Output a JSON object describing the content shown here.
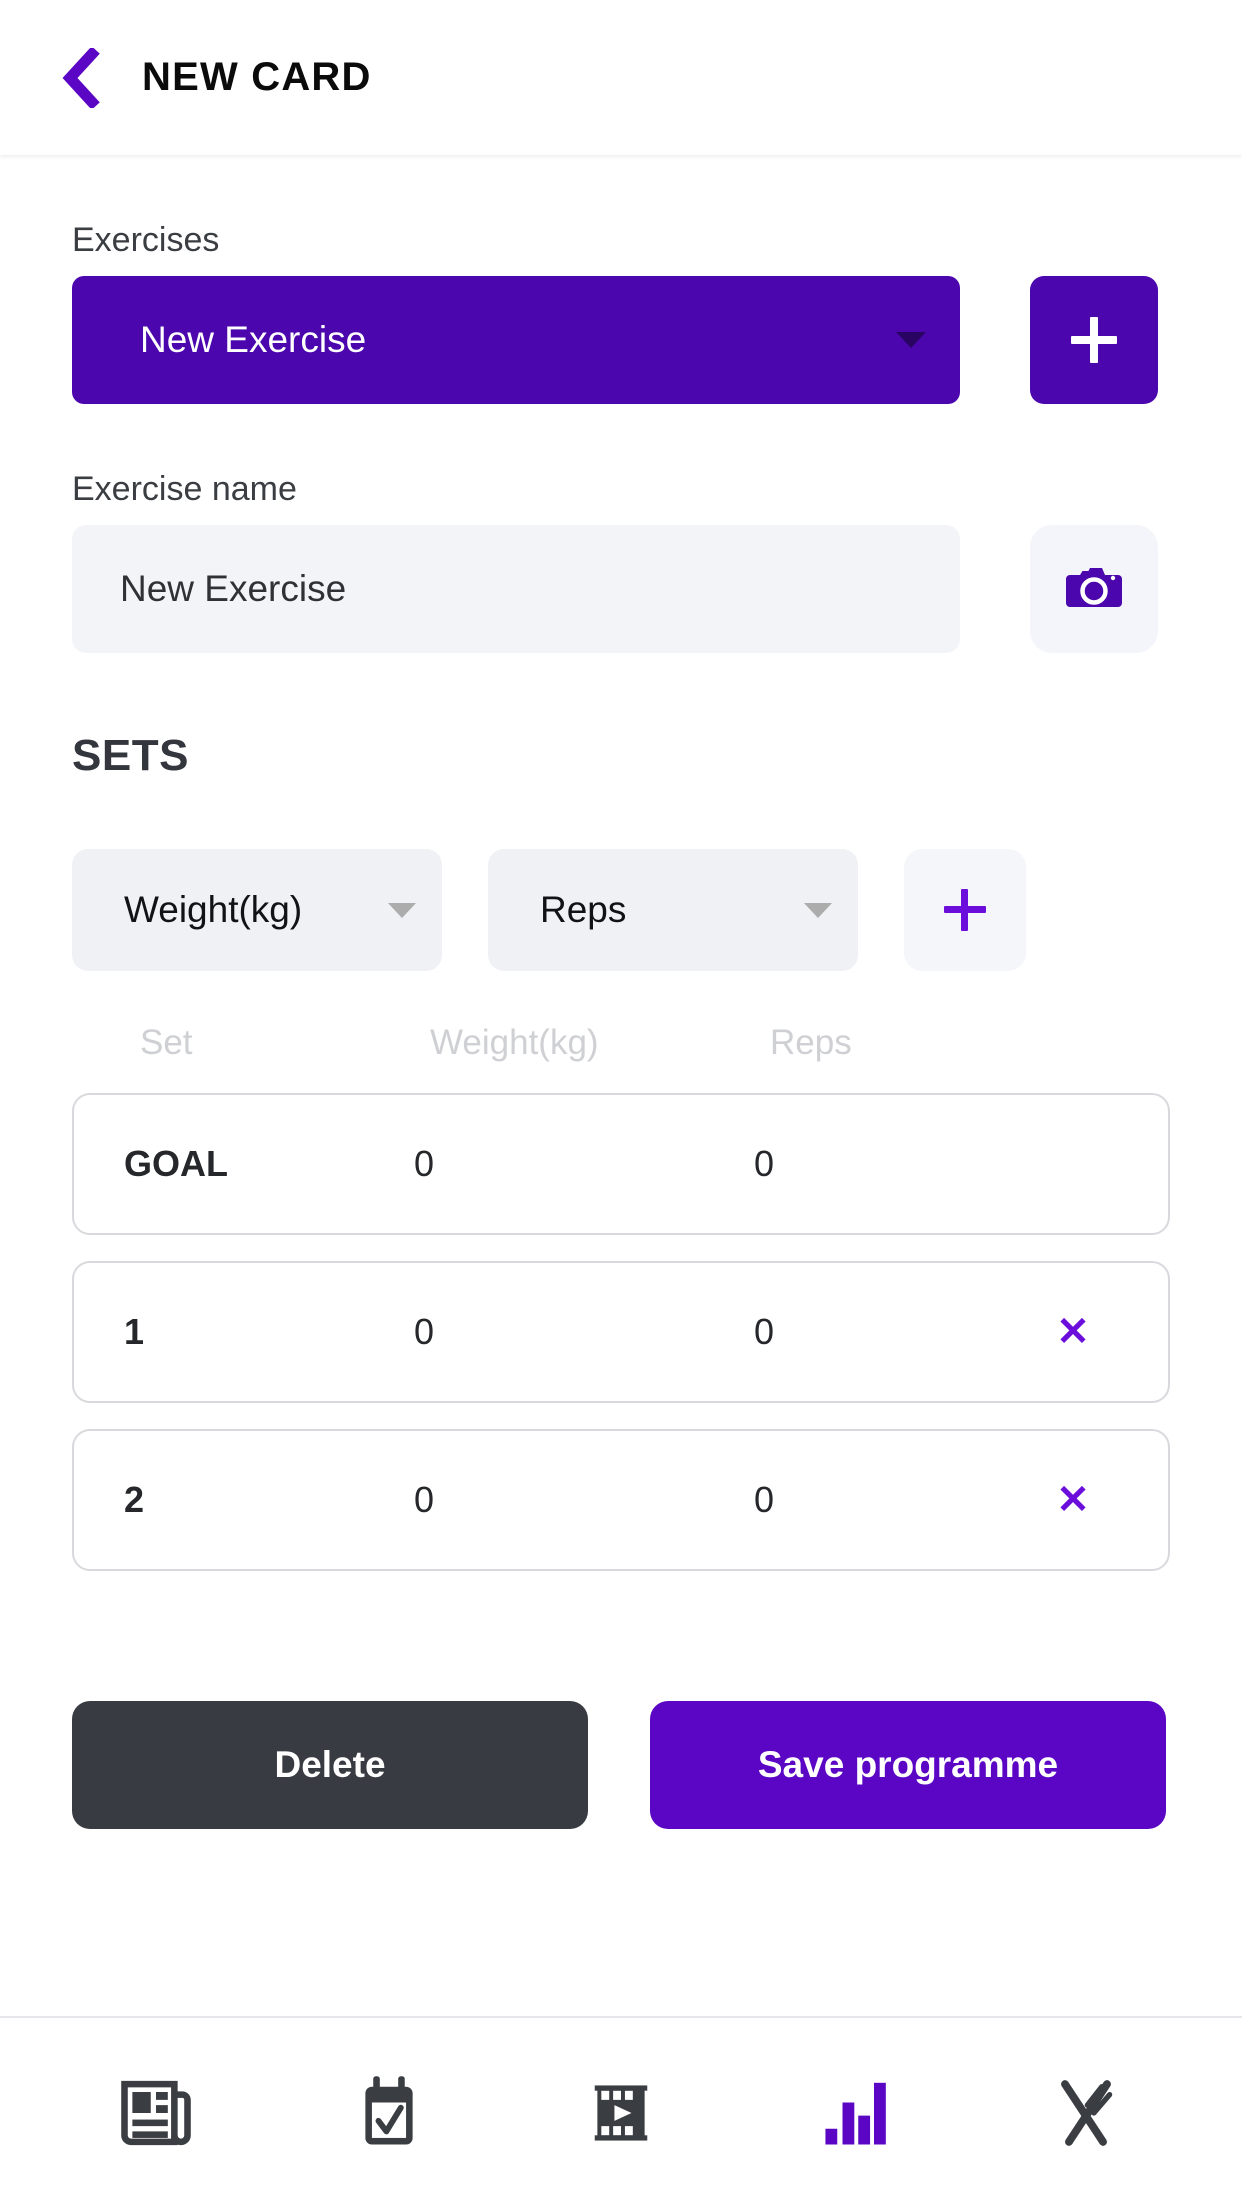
{
  "header": {
    "title": "NEW CARD",
    "back_icon": "chevron-left-icon"
  },
  "form": {
    "exercises_label": "Exercises",
    "exercise_select_value": "New Exercise",
    "add_exercise_icon": "plus-icon",
    "exercise_name_label": "Exercise name",
    "exercise_name_value": "New Exercise",
    "exercise_name_placeholder": "Exercise name",
    "camera_icon": "camera-icon"
  },
  "sets": {
    "title": "SETS",
    "metric_one": "Weight(kg)",
    "metric_two": "Reps",
    "add_set_icon": "plus-icon",
    "columns": [
      "Set",
      "Weight(kg)",
      "Reps"
    ],
    "rows": [
      {
        "set": "GOAL",
        "weight": "0",
        "reps": "0",
        "removable": false
      },
      {
        "set": "1",
        "weight": "0",
        "reps": "0",
        "removable": true,
        "remove_label": "✕"
      },
      {
        "set": "2",
        "weight": "0",
        "reps": "0",
        "removable": true,
        "remove_label": "✕"
      }
    ]
  },
  "actions": {
    "delete_label": "Delete",
    "save_label": "Save programme"
  },
  "bottom_nav": {
    "items": [
      {
        "name": "newspaper-icon",
        "active": false
      },
      {
        "name": "calendar-check-icon",
        "active": false
      },
      {
        "name": "film-icon",
        "active": false
      },
      {
        "name": "bar-chart-icon",
        "active": true
      },
      {
        "name": "cutlery-icon",
        "active": false
      }
    ]
  },
  "colors": {
    "brand_purple": "#4B06AE",
    "accent_purple": "#6B0DDB",
    "save_purple": "#5B06C4",
    "dark_slate": "#383B41",
    "light_gray": "#F0F1F4",
    "border_gray": "#D8D9DC"
  }
}
